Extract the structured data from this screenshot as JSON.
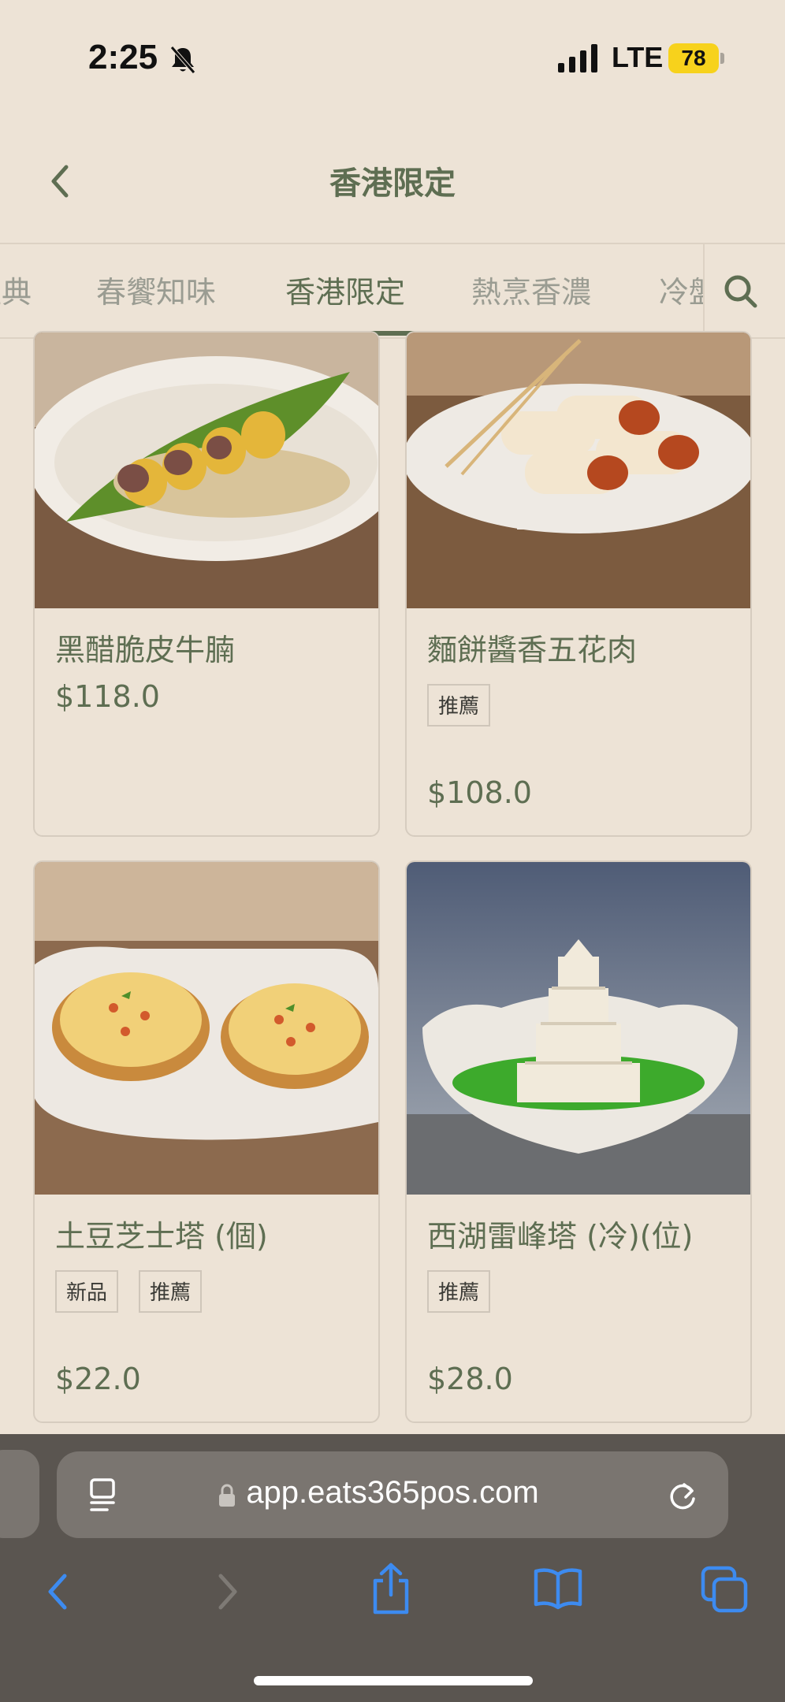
{
  "status_bar": {
    "time": "2:25",
    "network": "LTE",
    "battery": "78"
  },
  "header": {
    "title": "香港限定"
  },
  "tabs": [
    {
      "label": "經典"
    },
    {
      "label": "春饗知味"
    },
    {
      "label": "香港限定"
    },
    {
      "label": "熱烹香濃"
    },
    {
      "label": "冷盤"
    }
  ],
  "items": [
    {
      "name": "黑醋脆皮牛腩",
      "price": "$118.0",
      "badges": []
    },
    {
      "name": "麵餅醬香五花肉",
      "price": "$108.0",
      "badges": [
        "推薦"
      ]
    },
    {
      "name": "土豆芝士塔 (個)",
      "price": "$22.0",
      "badges": [
        "新品",
        "推薦"
      ]
    },
    {
      "name": "西湖雷峰塔 (冷)(位)",
      "price": "$28.0",
      "badges": [
        "推薦"
      ]
    }
  ],
  "browser": {
    "url": "app.eats365pos.com"
  },
  "colors": {
    "accent": "#5E6E52",
    "background": "#EDE3D6",
    "browser_bar": "#5A5550",
    "link_blue": "#3D8BF0"
  }
}
